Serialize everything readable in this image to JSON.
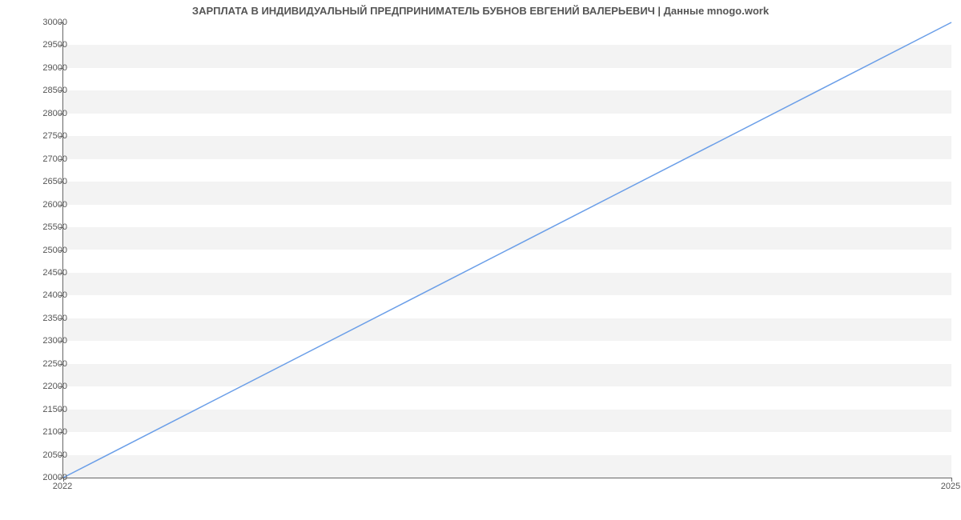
{
  "chart_data": {
    "type": "line",
    "title": "ЗАРПЛАТА В ИНДИВИДУАЛЬНЫЙ ПРЕДПРИНИМАТЕЛЬ БУБНОВ ЕВГЕНИЙ ВАЛЕРЬЕВИЧ | Данные mnogo.work",
    "x": [
      2022,
      2025
    ],
    "series": [
      {
        "name": "salary",
        "values": [
          20000,
          30000
        ],
        "color": "#6a9ee8"
      }
    ],
    "xlabel": "",
    "ylabel": "",
    "ylim": [
      20000,
      30000
    ],
    "xlim": [
      2022,
      2025
    ],
    "y_ticks": [
      20000,
      20500,
      21000,
      21500,
      22000,
      22500,
      23000,
      23500,
      24000,
      24500,
      25000,
      25500,
      26000,
      26500,
      27000,
      27500,
      28000,
      28500,
      29000,
      29500,
      30000
    ],
    "x_ticks": [
      2022,
      2025
    ],
    "grid": {
      "y_bands": true
    }
  }
}
